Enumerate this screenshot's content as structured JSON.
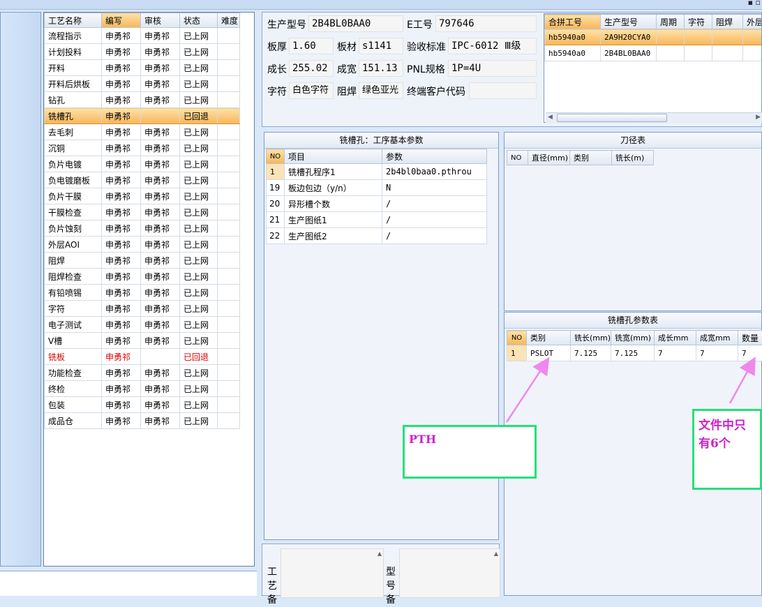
{
  "window": {
    "controls": "▪ ▫"
  },
  "process": {
    "headers": [
      "工艺名称",
      "编写",
      "审核",
      "状态",
      "难度"
    ],
    "rows": [
      {
        "name": "流程指示",
        "author": "申勇祁",
        "reviewer": "申勇祁",
        "status": "已上网"
      },
      {
        "name": "计划投料",
        "author": "申勇祁",
        "reviewer": "申勇祁",
        "status": "已上网"
      },
      {
        "name": "开料",
        "author": "申勇祁",
        "reviewer": "申勇祁",
        "status": "已上网"
      },
      {
        "name": "开料后烘板",
        "author": "申勇祁",
        "reviewer": "申勇祁",
        "status": "已上网"
      },
      {
        "name": "钻孔",
        "author": "申勇祁",
        "reviewer": "申勇祁",
        "status": "已上网"
      },
      {
        "name": "铣槽孔",
        "author": "申勇祁",
        "reviewer": "",
        "status": "已回退"
      },
      {
        "name": "去毛刺",
        "author": "申勇祁",
        "reviewer": "申勇祁",
        "status": "已上网"
      },
      {
        "name": "沉铜",
        "author": "申勇祁",
        "reviewer": "申勇祁",
        "status": "已上网"
      },
      {
        "name": "负片电镀",
        "author": "申勇祁",
        "reviewer": "申勇祁",
        "status": "已上网"
      },
      {
        "name": "负电镀磨板",
        "author": "申勇祁",
        "reviewer": "申勇祁",
        "status": "已上网"
      },
      {
        "name": "负片干膜",
        "author": "申勇祁",
        "reviewer": "申勇祁",
        "status": "已上网"
      },
      {
        "name": "干膜检查",
        "author": "申勇祁",
        "reviewer": "申勇祁",
        "status": "已上网"
      },
      {
        "name": "负片蚀刻",
        "author": "申勇祁",
        "reviewer": "申勇祁",
        "status": "已上网"
      },
      {
        "name": "外层AOI",
        "author": "申勇祁",
        "reviewer": "申勇祁",
        "status": "已上网"
      },
      {
        "name": "阻焊",
        "author": "申勇祁",
        "reviewer": "申勇祁",
        "status": "已上网"
      },
      {
        "name": "阻焊检查",
        "author": "申勇祁",
        "reviewer": "申勇祁",
        "status": "已上网"
      },
      {
        "name": "有铅喷锡",
        "author": "申勇祁",
        "reviewer": "申勇祁",
        "status": "已上网"
      },
      {
        "name": "字符",
        "author": "申勇祁",
        "reviewer": "申勇祁",
        "status": "已上网"
      },
      {
        "name": "电子测试",
        "author": "申勇祁",
        "reviewer": "申勇祁",
        "status": "已上网"
      },
      {
        "name": "V槽",
        "author": "申勇祁",
        "reviewer": "申勇祁",
        "status": "已上网"
      },
      {
        "name": "铣板",
        "author": "申勇祁",
        "reviewer": "",
        "status": "已回退"
      },
      {
        "name": "功能检查",
        "author": "申勇祁",
        "reviewer": "申勇祁",
        "status": "已上网"
      },
      {
        "name": "终检",
        "author": "申勇祁",
        "reviewer": "申勇祁",
        "status": "已上网"
      },
      {
        "name": "包装",
        "author": "申勇祁",
        "reviewer": "申勇祁",
        "status": "已上网"
      },
      {
        "name": "成品仓",
        "author": "申勇祁",
        "reviewer": "申勇祁",
        "status": "已上网"
      }
    ]
  },
  "info": {
    "model_label": "生产型号",
    "model": "2B4BL0BAA0",
    "eno_label": "E工号",
    "eno": "797646",
    "thick_label": "板厚",
    "thick": "1.60",
    "material_label": "板材",
    "material": "s1141",
    "std_label": "验收标准",
    "std": "IPC-6012 Ⅲ级",
    "len_label": "成长",
    "len": "255.02",
    "wid_label": "成宽",
    "wid": "151.13",
    "pnl_label": "PNL规格",
    "pnl": "1P=4U",
    "char_label": "字符",
    "char": "白色字符",
    "mask_label": "阻焊",
    "mask": "绿色亚光",
    "cust_label": "终端客户代码",
    "cust": ""
  },
  "combo": {
    "headers": [
      "合拼工号",
      "生产型号",
      "周期",
      "字符",
      "阻焊",
      "外层"
    ],
    "rows": [
      [
        "hb5940a0",
        "2A9H20CYA0",
        "",
        "",
        "",
        ""
      ],
      [
        "hb5940a0",
        "2B4BL0BAA0",
        "",
        "",
        "",
        ""
      ]
    ]
  },
  "param": {
    "title": "铣槽孔：工序基本参数",
    "headers": [
      "NO",
      "项目",
      "参数"
    ],
    "rows": [
      [
        "1",
        "铣槽孔程序1",
        "2b4bl0baa0.pthrou"
      ],
      [
        "19",
        "板边包边（y/n）",
        "N"
      ],
      [
        "20",
        "异形槽个数",
        "/"
      ],
      [
        "21",
        "生产图纸1",
        "/"
      ],
      [
        "22",
        "生产图纸2",
        "/"
      ]
    ]
  },
  "knife": {
    "title": "刀径表",
    "headers": [
      "NO",
      "直径(mm)",
      "类别",
      "铣长(m)"
    ]
  },
  "slot": {
    "title": "铣槽孔参数表",
    "headers": [
      "NO",
      "类别",
      "铣长(mm)",
      "铣宽(mm)",
      "成长mm",
      "成宽mm",
      "数量"
    ],
    "rows": [
      [
        "1",
        "PSLOT",
        "7.125",
        "7.125",
        "7",
        "7",
        "7"
      ]
    ]
  },
  "bottom": {
    "label1": "工艺备",
    "label2": "型号备"
  },
  "annotations": {
    "pth": "PTH",
    "note1": "文件中只",
    "note2": "有6个"
  },
  "colors": {
    "accent": "#f8b659",
    "annot_border": "#25e07a",
    "annot_text": "#cc22cc",
    "arrow": "#ee88ee"
  }
}
